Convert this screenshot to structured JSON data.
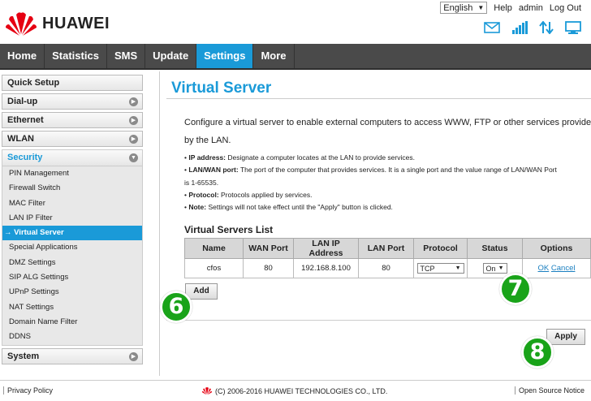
{
  "header": {
    "brand": "HUAWEI",
    "language": "English",
    "help": "Help",
    "user": "admin",
    "logout": "Log Out"
  },
  "nav": {
    "items": [
      "Home",
      "Statistics",
      "SMS",
      "Update",
      "Settings",
      "More"
    ],
    "active": "Settings"
  },
  "sidebar": {
    "quick_setup": "Quick Setup",
    "dialup": "Dial-up",
    "ethernet": "Ethernet",
    "wlan": "WLAN",
    "security": "Security",
    "security_items": [
      "PIN Management",
      "Firewall Switch",
      "MAC Filter",
      "LAN IP Filter",
      "→ Virtual Server",
      "Special Applications",
      "DMZ Settings",
      "SIP ALG Settings",
      "UPnP Settings",
      "NAT Settings",
      "Domain Name Filter",
      "DDNS"
    ],
    "system": "System"
  },
  "main": {
    "title": "Virtual Server",
    "desc_line1": "Configure a virtual server to enable external computers to access WWW, FTP or other services provided",
    "desc_line2": "by the LAN.",
    "bullets": {
      "ip_label": "IP address:",
      "ip_text": " Designate a computer locates at the LAN to provide services.",
      "port_label": "LAN/WAN port:",
      "port_text": " The port of the computer that provides services. It is a single port and the value range of LAN/WAN Port",
      "port_text2": "is 1-65535.",
      "protocol_label": "Protocol:",
      "protocol_text": " Protocols applied by services.",
      "note_label": "Note:",
      "note_text": " Settings will not take effect until the \"Apply\" button is clicked."
    },
    "list_title": "Virtual Servers List",
    "table": {
      "headers": [
        "Name",
        "WAN Port",
        "LAN IP Address",
        "LAN Port",
        "Protocol",
        "Status",
        "Options"
      ],
      "row": {
        "name": "cfos",
        "wan_port": "80",
        "lan_ip": "192.168.8.100",
        "lan_port": "80",
        "protocol": "TCP",
        "status": "On",
        "ok": "OK",
        "cancel": "Cancel"
      }
    },
    "add_button": "Add",
    "apply_button": "Apply"
  },
  "badges": {
    "six": "6",
    "seven": "7",
    "eight": "8"
  },
  "footer": {
    "privacy": "Privacy Policy",
    "copyright": "(C) 2006-2016 HUAWEI TECHNOLOGIES CO., LTD.",
    "open_source": "Open Source Notice"
  },
  "colors": {
    "accent": "#1a9ad8",
    "nav_bg": "#4a4a4a",
    "badge": "#19a319",
    "brand_red": "#e60012"
  }
}
